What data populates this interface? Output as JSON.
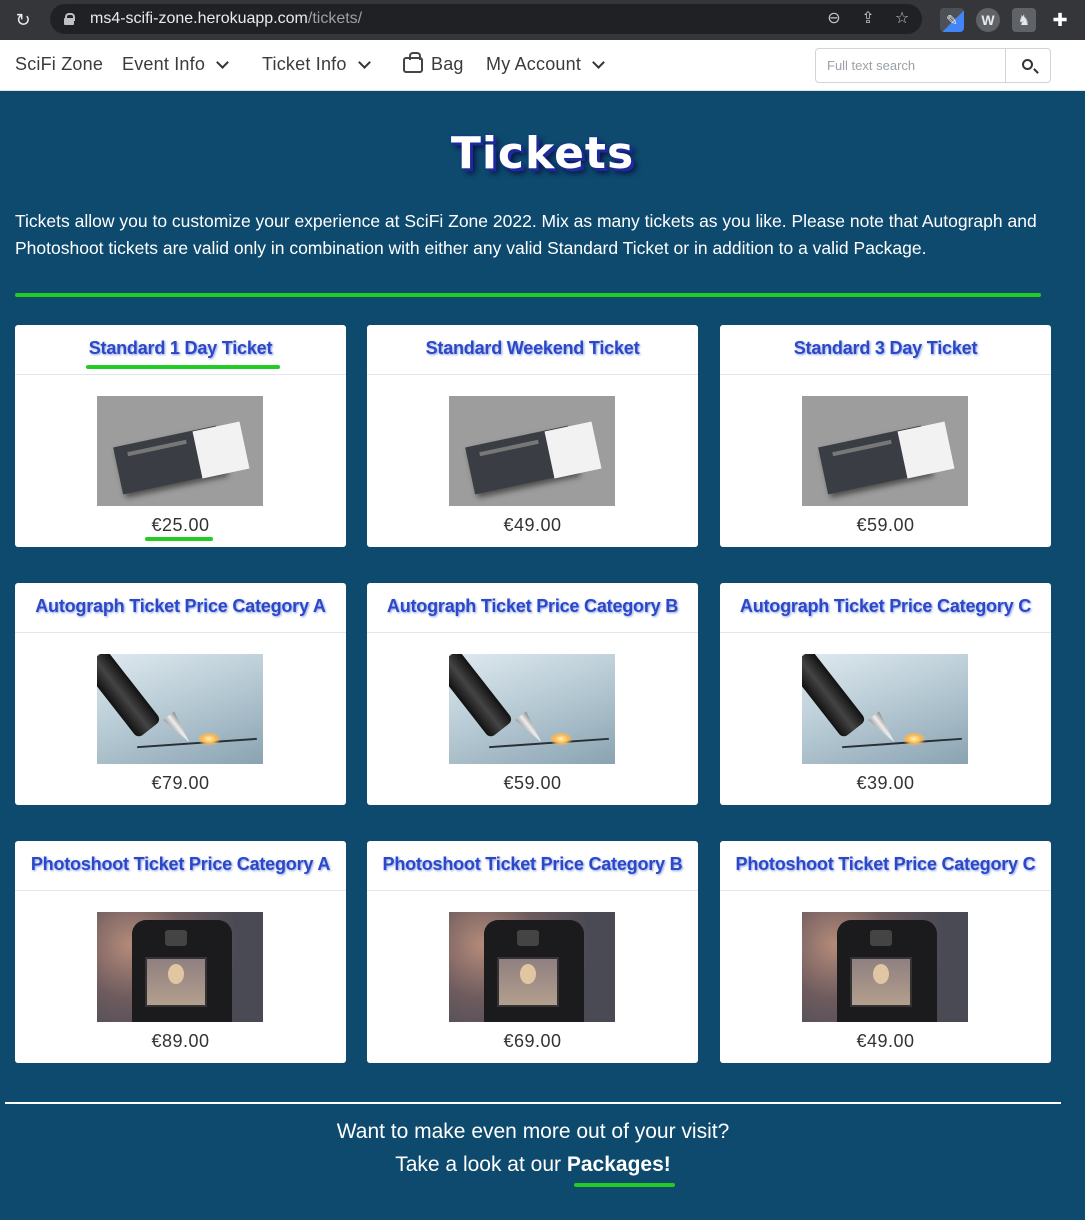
{
  "browser": {
    "url_host": "ms4-scifi-zone.herokuapp.com",
    "url_path": "/tickets/"
  },
  "nav": {
    "brand": "SciFi Zone",
    "event_info": "Event Info",
    "ticket_info": "Ticket Info",
    "bag": "Bag",
    "my_account": "My Account",
    "search_placeholder": "Full text search"
  },
  "page": {
    "title": "Tickets",
    "intro": "Tickets allow you to customize your experience at SciFi Zone 2022. Mix as many tickets as you like. Please note that Autograph and Photoshoot tickets are valid only in combination with either any valid Standard Ticket or in addition to a valid Package."
  },
  "tickets": [
    {
      "title": "Standard 1 Day Ticket",
      "price": "€25.00",
      "image": "ticket-image"
    },
    {
      "title": "Standard Weekend Ticket",
      "price": "€49.00",
      "image": "ticket-image"
    },
    {
      "title": "Standard 3 Day Ticket",
      "price": "€59.00",
      "image": "ticket-image"
    },
    {
      "title": "Autograph Ticket Price Category A",
      "price": "€79.00",
      "image": "pen-image"
    },
    {
      "title": "Autograph Ticket Price Category B",
      "price": "€59.00",
      "image": "pen-image"
    },
    {
      "title": "Autograph Ticket Price Category C",
      "price": "€39.00",
      "image": "pen-image"
    },
    {
      "title": "Photoshoot Ticket Price Category A",
      "price": "€89.00",
      "image": "camera-image"
    },
    {
      "title": "Photoshoot Ticket Price Category B",
      "price": "€69.00",
      "image": "camera-image"
    },
    {
      "title": "Photoshoot Ticket Price Category C",
      "price": "€49.00",
      "image": "camera-image"
    }
  ],
  "cta": {
    "line1": "Want to make even more out of your visit?",
    "line2_prefix": "Take a look at our ",
    "line2_link": "Packages!"
  },
  "colors": {
    "page_background": "#0d4a6e",
    "accent_green": "#22cc22",
    "card_title": "#2c47c8"
  }
}
